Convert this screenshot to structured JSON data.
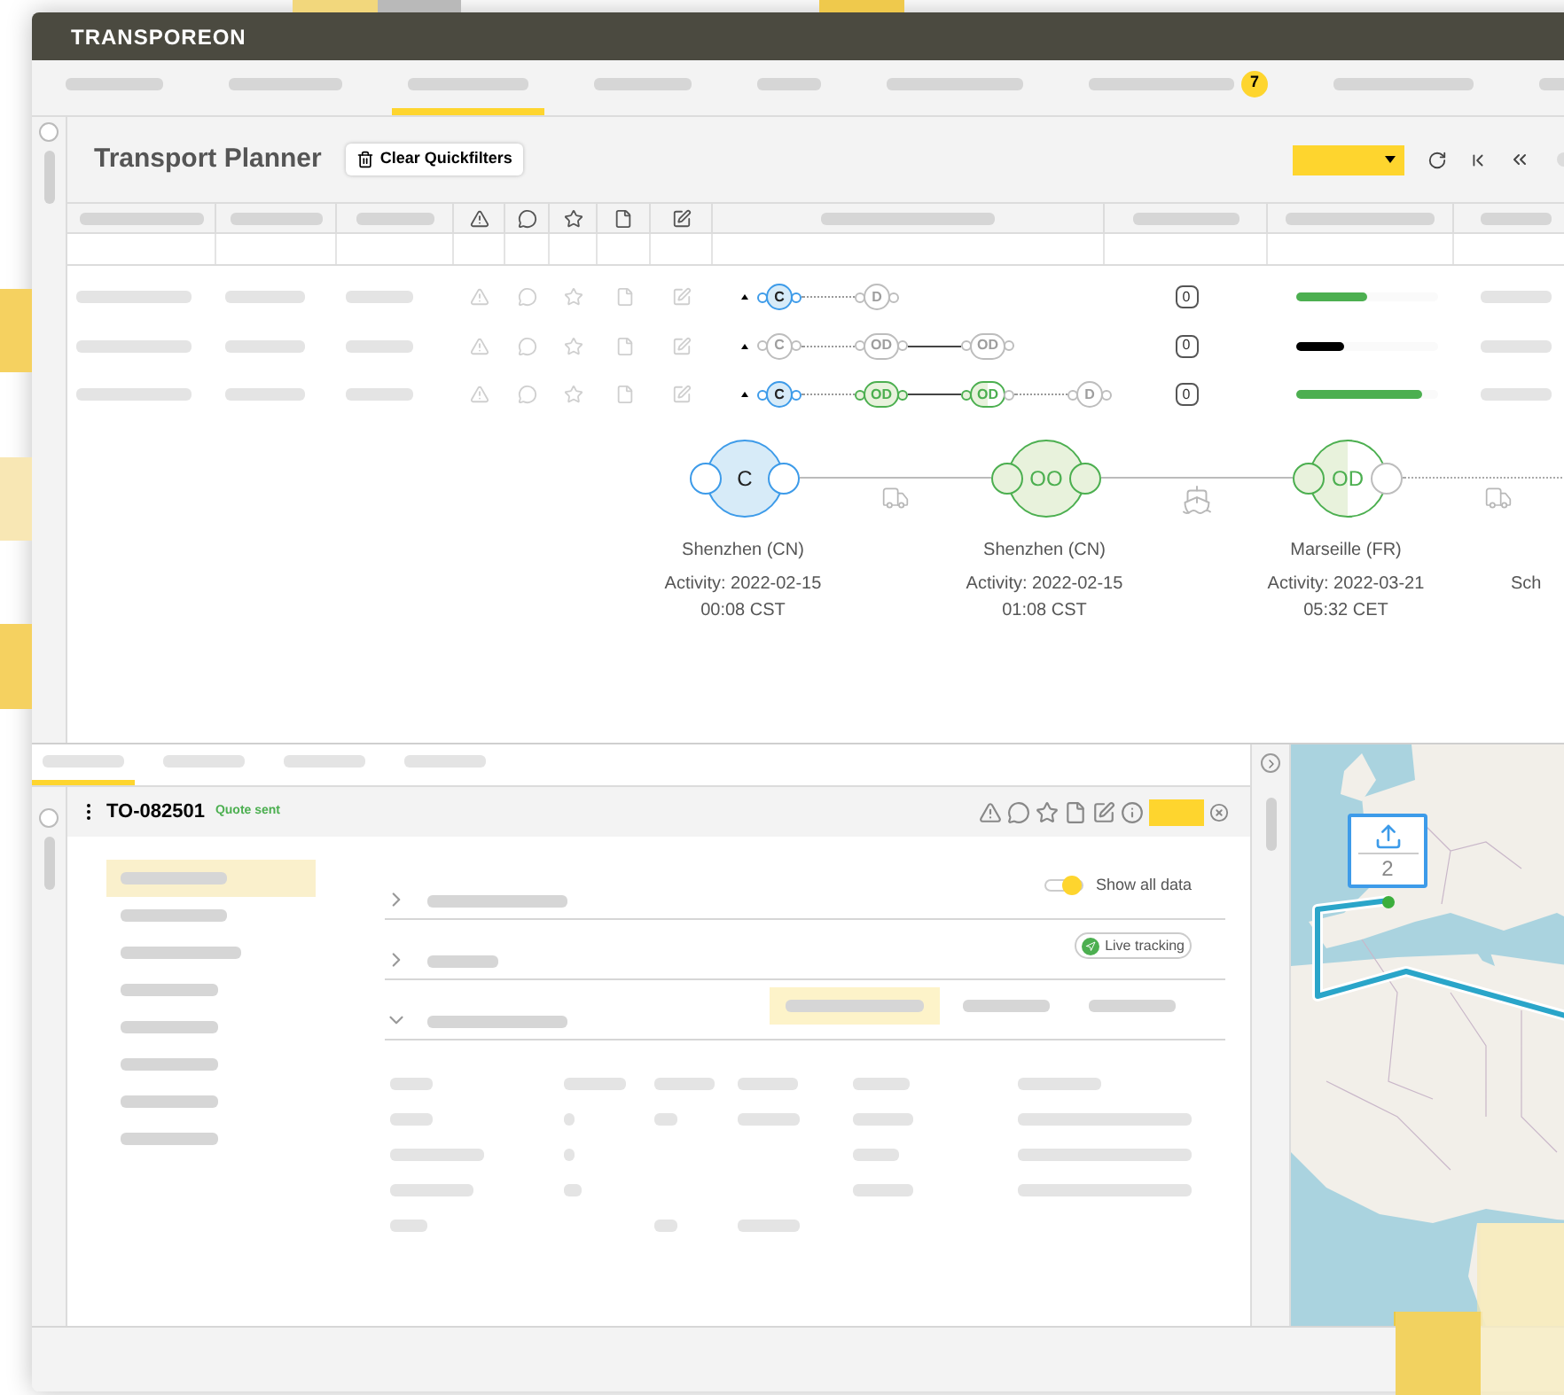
{
  "brand": {
    "logo": "TRANSPOREON"
  },
  "nav_tabs": [
    {
      "selected": false
    },
    {
      "selected": false
    },
    {
      "selected": true
    },
    {
      "selected": false
    },
    {
      "selected": false
    },
    {
      "selected": false
    },
    {
      "selected": false,
      "badge": "7"
    },
    {
      "selected": false
    },
    {
      "selected": false
    }
  ],
  "planner": {
    "title": "Transport Planner",
    "clear_button": "Clear Quickfilters",
    "rows": [
      {
        "nodes": [
          {
            "code": "C",
            "kind": "current"
          },
          {
            "code": "D",
            "kind": "pending"
          }
        ],
        "links": [
          {
            "dotted": true
          }
        ],
        "count": "0",
        "level": 0.5,
        "color": "#4caf50"
      },
      {
        "nodes": [
          {
            "code": "C",
            "kind": "pending"
          },
          {
            "code": "OD",
            "kind": "pending"
          },
          {
            "code": "OD",
            "kind": "pending"
          }
        ],
        "links": [
          {
            "dotted": true
          },
          {
            "dotted": false
          }
        ],
        "count": "0",
        "level": 0.34,
        "color": "#000000"
      },
      {
        "nodes": [
          {
            "code": "C",
            "kind": "current"
          },
          {
            "code": "OD",
            "kind": "done"
          },
          {
            "code": "OD",
            "kind": "partial"
          },
          {
            "code": "D",
            "kind": "pending"
          }
        ],
        "links": [
          {
            "dotted": true
          },
          {
            "dotted": false
          },
          {
            "dotted": true
          }
        ],
        "count": "0",
        "level": 0.89,
        "color": "#4caf50"
      }
    ],
    "stops": [
      {
        "code": "C",
        "kind": "current",
        "city": "Shenzhen (CN)",
        "activity": "Activity: 2022-02-15",
        "time": "00:08 CST"
      },
      {
        "code": "OO",
        "kind": "done",
        "city": "Shenzhen (CN)",
        "activity": "Activity: 2022-02-15",
        "time": "01:08 CST"
      },
      {
        "code": "OD",
        "kind": "partial",
        "city": "Marseille (FR)",
        "activity": "Activity: 2022-03-21",
        "time": "05:32 CET"
      }
    ],
    "legs": [
      {
        "kind": "truck",
        "dotted": false
      },
      {
        "kind": "ship",
        "dotted": false
      },
      {
        "kind": "truck",
        "dotted": true
      }
    ],
    "next_stop_city": "Sch"
  },
  "detail_tabs": [
    {
      "selected": true
    },
    {
      "selected": false
    },
    {
      "selected": false
    },
    {
      "selected": false
    }
  ],
  "detail": {
    "order": "TO-082501",
    "status": "Quote sent",
    "menu": [
      {
        "selected": true
      },
      {
        "selected": false
      },
      {
        "selected": false
      },
      {
        "selected": false
      },
      {
        "selected": false
      },
      {
        "selected": false
      },
      {
        "selected": false
      },
      {
        "selected": false
      }
    ],
    "sections": [
      {
        "kind": "toggle",
        "expanded": false,
        "label": "Show all data",
        "on": true
      },
      {
        "kind": "badge",
        "expanded": false,
        "label": "Live tracking"
      },
      {
        "kind": "tabs",
        "expanded": true,
        "tabs": [
          {
            "selected": true
          },
          {
            "selected": false
          },
          {
            "selected": false
          }
        ]
      }
    ]
  },
  "map": {
    "marker_count": "2"
  }
}
